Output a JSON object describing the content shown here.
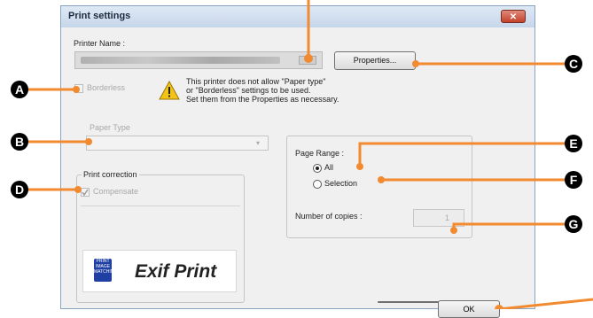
{
  "window": {
    "title": "Print settings",
    "close_glyph": "✕"
  },
  "printer": {
    "label": "Printer Name :",
    "properties_button": "Properties..."
  },
  "borderless": {
    "label": "Borderless",
    "checked": false,
    "enabled": false
  },
  "notice": {
    "icon": "warning-icon",
    "lines": [
      "This printer does not allow \"Paper type\"",
      "or \"Borderless\" settings to be used.",
      "Set them from the Properties as necessary."
    ]
  },
  "paper_type": {
    "label": "Paper Type",
    "value": "",
    "enabled": false
  },
  "page_range": {
    "label": "Page Range :",
    "options": [
      "All",
      "Selection"
    ],
    "selected": "All"
  },
  "copies": {
    "label": "Number of copies :",
    "value": "1"
  },
  "print_correction": {
    "label": "Print correction",
    "checkbox_label": "Compensate",
    "checked": true,
    "enabled": false,
    "logo_text": "Exif Print",
    "badge_text": "PRINT IMAGE MATCHING"
  },
  "ok_button": "OK",
  "callouts": {
    "A": "A",
    "B": "B",
    "C": "C",
    "D": "D",
    "E": "E",
    "F": "F",
    "G": "G"
  },
  "colors": {
    "callout": "#000000",
    "leader_line": "#f28a30",
    "title_bar": "#c6d6ea",
    "window_bg": "#f0f0f0"
  }
}
